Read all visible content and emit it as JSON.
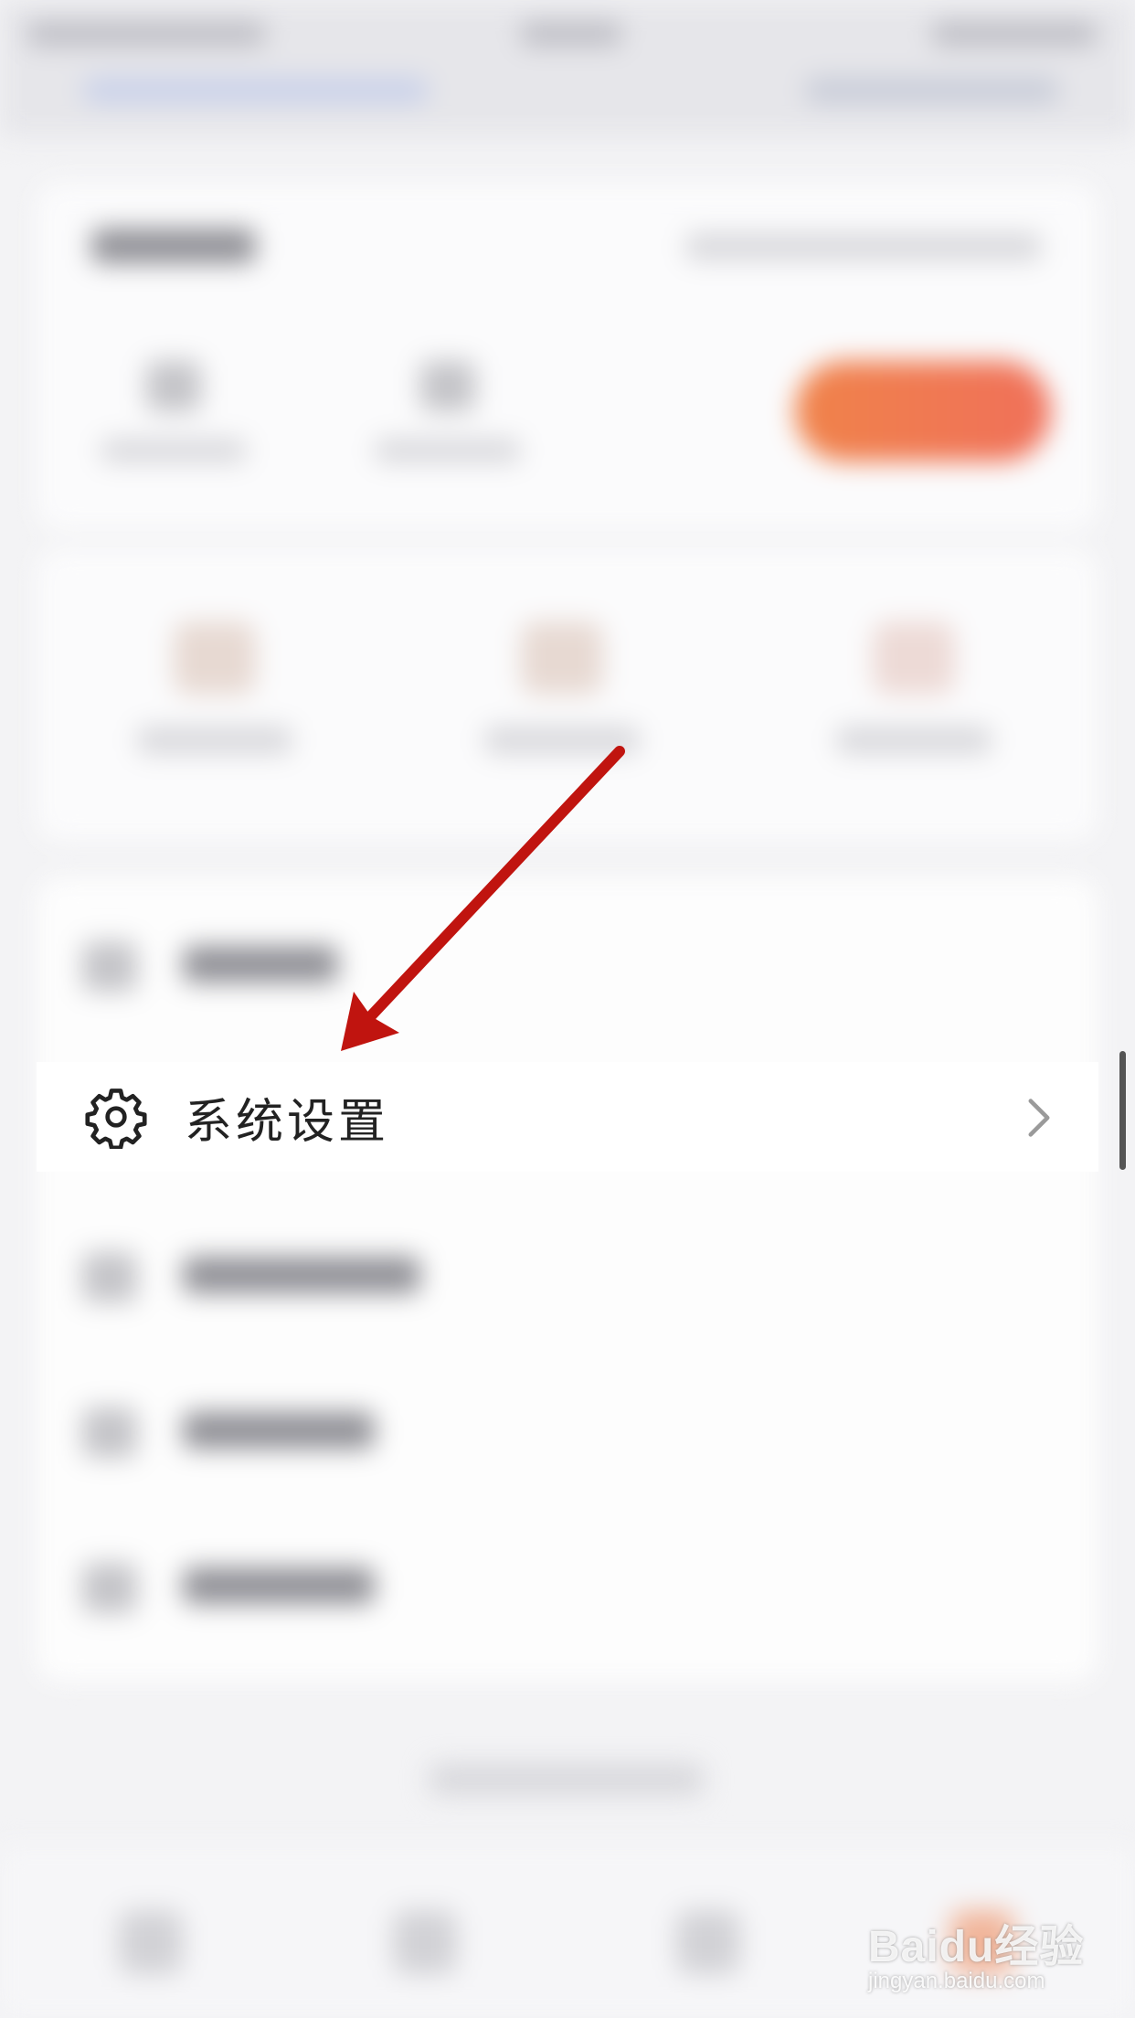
{
  "settings_row": {
    "label": "系统设置",
    "icon": "gear-icon",
    "chevron_icon": "chevron-right-icon"
  },
  "annotation": {
    "arrow_color": "#c0140f"
  },
  "watermark": {
    "main": "Baidu经验",
    "sub": "jingyan.baidu.com"
  },
  "colors": {
    "accent_orange": "#f0784e",
    "row_background": "#ffffff",
    "text": "#222222"
  }
}
